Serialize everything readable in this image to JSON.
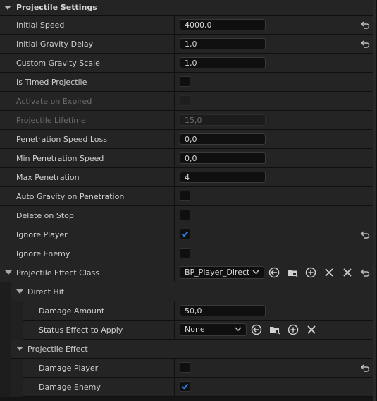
{
  "section": {
    "title": "Projectile Settings"
  },
  "rows": {
    "initial_speed": {
      "label": "Initial Speed",
      "value": "4000,0"
    },
    "initial_gravity_delay": {
      "label": "Initial Gravity Delay",
      "value": "1,0"
    },
    "custom_gravity_scale": {
      "label": "Custom Gravity Scale",
      "value": "1,0"
    },
    "is_timed_projectile": {
      "label": "Is Timed Projectile",
      "checked": false
    },
    "activate_on_expired": {
      "label": "Activate on Expired",
      "checked": false
    },
    "projectile_lifetime": {
      "label": "Projectile Lifetime",
      "value": "15,0"
    },
    "penetration_speed_loss": {
      "label": "Penetration Speed Loss",
      "value": "0,0"
    },
    "min_penetration_speed": {
      "label": "Min Penetration Speed",
      "value": "0,0"
    },
    "max_penetration": {
      "label": "Max Penetration",
      "value": "4"
    },
    "auto_gravity_on_penetration": {
      "label": "Auto Gravity on Penetration",
      "checked": false
    },
    "delete_on_stop": {
      "label": "Delete on Stop",
      "checked": false
    },
    "ignore_player": {
      "label": "Ignore Player",
      "checked": true
    },
    "ignore_enemy": {
      "label": "Ignore Enemy",
      "checked": false
    },
    "projectile_effect_class": {
      "label": "Projectile Effect Class",
      "value": "BP_Player_Direct"
    },
    "direct_hit": {
      "label": "Direct Hit"
    },
    "damage_amount": {
      "label": "Damage Amount",
      "value": "50,0"
    },
    "status_effect_to_apply": {
      "label": "Status Effect to Apply",
      "value": "None"
    },
    "projectile_effect": {
      "label": "Projectile Effect"
    },
    "damage_player": {
      "label": "Damage Player",
      "checked": false
    },
    "damage_enemy": {
      "label": "Damage Enemy",
      "checked": true
    }
  },
  "icons": {
    "reset": "reset-to-default-icon",
    "use_selected": "use-selected-asset-icon",
    "browse": "browse-asset-icon",
    "add": "add-icon",
    "clear": "clear-icon",
    "delete": "delete-icon",
    "check": "checkmark-icon"
  },
  "colors": {
    "accent": "#2f7fe0",
    "background": "#242424"
  }
}
